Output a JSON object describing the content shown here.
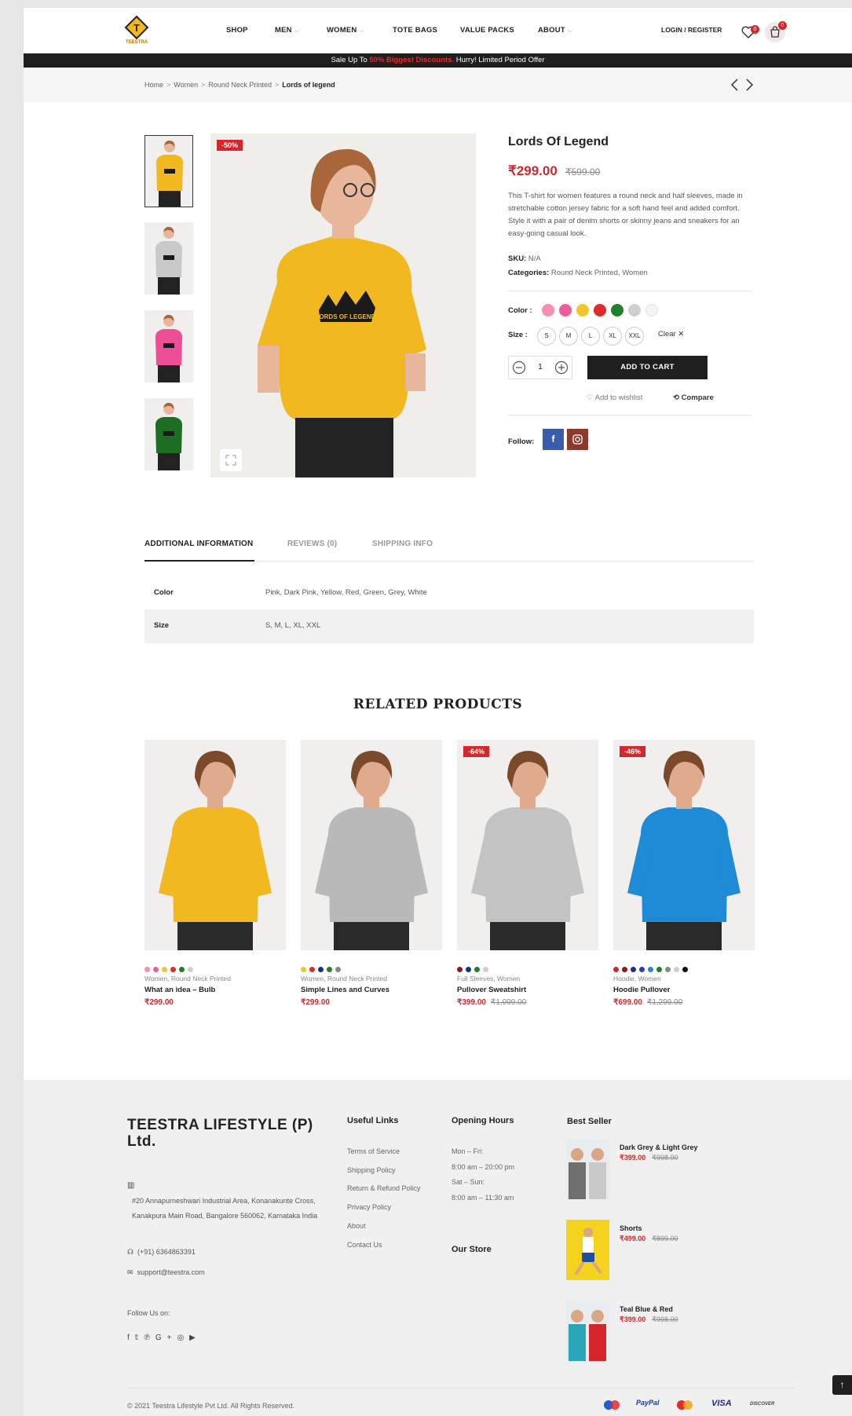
{
  "header": {
    "logo_text": "TEESTRA",
    "nav": [
      {
        "label": "SHOP",
        "dropdown": false
      },
      {
        "label": "MEN",
        "dropdown": true
      },
      {
        "label": "WOMEN",
        "dropdown": true
      },
      {
        "label": "TOTE BAGS",
        "dropdown": false
      },
      {
        "label": "VALUE PACKS",
        "dropdown": false
      },
      {
        "label": "ABOUT",
        "dropdown": true
      }
    ],
    "login_label": "LOGIN / REGISTER",
    "wishlist_count": "0",
    "cart_count": "0"
  },
  "promo": {
    "before": "Sale Up To ",
    "highlight": "50% Biggest Discounts.",
    "after": " Hurry! Limited Period Offer"
  },
  "breadcrumb": [
    "Home",
    "Women",
    "Round Neck Printed",
    "Lords of legend"
  ],
  "product": {
    "sale_badge": "-50%",
    "title": "Lords Of Legend",
    "price": "₹299.00",
    "old_price": "₹599.00",
    "description": "This T-shirt for women features a round neck and half sleeves, made in stretchable cotton jersey fabric for a soft hand feel and added comfort. Style it with a pair of denim shorts or skinny jeans and sneakers for an easy-going casual look.",
    "sku_label": "SKU:",
    "sku_value": "N/A",
    "categories_label": "Categories:",
    "categories_value": "Round Neck Printed, Women",
    "color_label": "Color :",
    "colors": [
      "#f48fb1",
      "#ec5e9b",
      "#f3c52a",
      "#e02b2b",
      "#1f7f2a",
      "#cfcfcf",
      "#f4f4f4"
    ],
    "size_label": "Size :",
    "sizes": [
      "S",
      "M",
      "L",
      "XL",
      "XXL"
    ],
    "clear_label": "Clear",
    "quantity": "1",
    "add_to_cart": "ADD TO CART",
    "wishlist_label": "Add to wishlist",
    "compare_label": "Compare",
    "follow_label": "Follow:",
    "shirt_colors": [
      "#f2b81f",
      "#c9c9c9",
      "#ec4f96",
      "#1d6e22"
    ],
    "print_text": "LORDS OF LEGEND"
  },
  "tabs": [
    "ADDITIONAL INFORMATION",
    "REVIEWS (0)",
    "SHIPPING INFO"
  ],
  "info_table": [
    {
      "key": "Color",
      "value": "Pink, Dark Pink, Yellow, Red, Green, Grey, White"
    },
    {
      "key": "Size",
      "value": "S, M, L, XL, XXL"
    }
  ],
  "related": {
    "title": "RELATED PRODUCTS",
    "items": [
      {
        "badge": "",
        "category": "Women, Round Neck Printed",
        "name": "What an idea – Bulb",
        "price": "₹299.00",
        "old_price": "",
        "garment": "#f2b81f",
        "dots": [
          "#f48fb1",
          "#ec5e9b",
          "#f3c52a",
          "#e02b2b",
          "#1f7f2a",
          "#cfcfcf"
        ]
      },
      {
        "badge": "",
        "category": "Women, Round Neck Printed",
        "name": "Simple Lines and Curves",
        "price": "₹299.00",
        "old_price": "",
        "garment": "#b9b9b9",
        "dots": [
          "#f3c52a",
          "#e02b2b",
          "#1a2f8a",
          "#1f7f2a",
          "#888888"
        ]
      },
      {
        "badge": "-64%",
        "category": "Full Sleeves, Women",
        "name": "Pullover Sweatshirt",
        "price": "₹399.00",
        "old_price": "₹1,099.00",
        "garment": "#c3c3c3",
        "dots": [
          "#8b1d1d",
          "#1a2f8a",
          "#1f7f2a",
          "#cfcfcf"
        ]
      },
      {
        "badge": "-46%",
        "category": "Hoodie, Women",
        "name": "Hoodie Pullover",
        "price": "₹699.00",
        "old_price": "₹1,299.00",
        "garment": "#1f8ad6",
        "dots": [
          "#d6262b",
          "#8b1d1d",
          "#1a2f8a",
          "#2b3fae",
          "#1f8ad6",
          "#1f7f2a",
          "#888888",
          "#cfcfcf",
          "#111111"
        ]
      }
    ]
  },
  "footer": {
    "company": "TEESTRA LIFESTYLE (P) Ltd.",
    "address": "#20 Annapurneshwari Industrial Area, Konanakunte Cross, Kanakpura Main Road, Bangalore 560062, Karnataka India",
    "phone": "(+91) 6364863391",
    "email": "support@teestra.com",
    "follow_label": "Follow Us on:",
    "useful_links_title": "Useful Links",
    "useful_links": [
      "Terms of Service",
      "Shipping Policy",
      "Return & Refund Policy",
      "Privacy Policy",
      "About",
      "Contact Us"
    ],
    "hours_title": "Opening Hours",
    "hours": [
      "Mon – Fri:",
      "8:00 am – 20:00 pm",
      "Sat – Sun:",
      "8:00 am – 11:30 am"
    ],
    "store_title": "Our Store",
    "best_seller_title": "Best Seller",
    "best_sellers": [
      {
        "name": "Dark Grey & Light Grey",
        "price": "₹399.00",
        "old_price": "₹998.00"
      },
      {
        "name": "Shorts",
        "price": "₹499.00",
        "old_price": "₹899.00"
      },
      {
        "name": "Teal Blue & Red",
        "price": "₹399.00",
        "old_price": "₹998.00"
      }
    ],
    "copyright": "© 2021 Teestra Lifestyle Pvt Ltd. All Rights Reserved.",
    "payments": [
      "PayPal",
      "VISA",
      "DISCOVER"
    ]
  }
}
